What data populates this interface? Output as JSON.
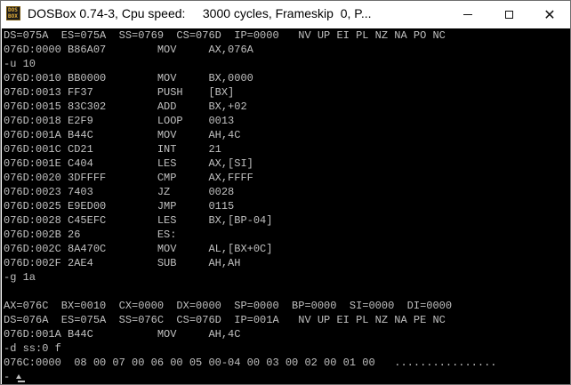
{
  "window": {
    "title": "DOSBox 0.74-3, Cpu speed:     3000 cycles, Frameskip  0, P...",
    "icon_text": [
      "DOS",
      "BOX"
    ],
    "close_label": "✕"
  },
  "console": {
    "lines": [
      "DS=075A  ES=075A  SS=0769  CS=076D  IP=0000   NV UP EI PL NZ NA PO NC",
      "076D:0000 B86A07        MOV     AX,076A",
      "-u 10",
      "076D:0010 BB0000        MOV     BX,0000",
      "076D:0013 FF37          PUSH    [BX]",
      "076D:0015 83C302        ADD     BX,+02",
      "076D:0018 E2F9          LOOP    0013",
      "076D:001A B44C          MOV     AH,4C",
      "076D:001C CD21          INT     21",
      "076D:001E C404          LES     AX,[SI]",
      "076D:0020 3DFFFF        CMP     AX,FFFF",
      "076D:0023 7403          JZ      0028",
      "076D:0025 E9ED00        JMP     0115",
      "076D:0028 C45EFC        LES     BX,[BP-04]",
      "076D:002B 26            ES:",
      "076D:002C 8A470C        MOV     AL,[BX+0C]",
      "076D:002F 2AE4          SUB     AH,AH",
      "-g 1a",
      "",
      "AX=076C  BX=0010  CX=0000  DX=0000  SP=0000  BP=0000  SI=0000  DI=0000",
      "DS=076A  ES=075A  SS=076C  CS=076D  IP=001A   NV UP EI PL NZ NA PE NC",
      "076D:001A B44C          MOV     AH,4C",
      "-d ss:0 f",
      "076C:0000  08 00 07 00 06 00 05 00-04 00 03 00 02 00 01 00   ................",
      "-"
    ]
  }
}
